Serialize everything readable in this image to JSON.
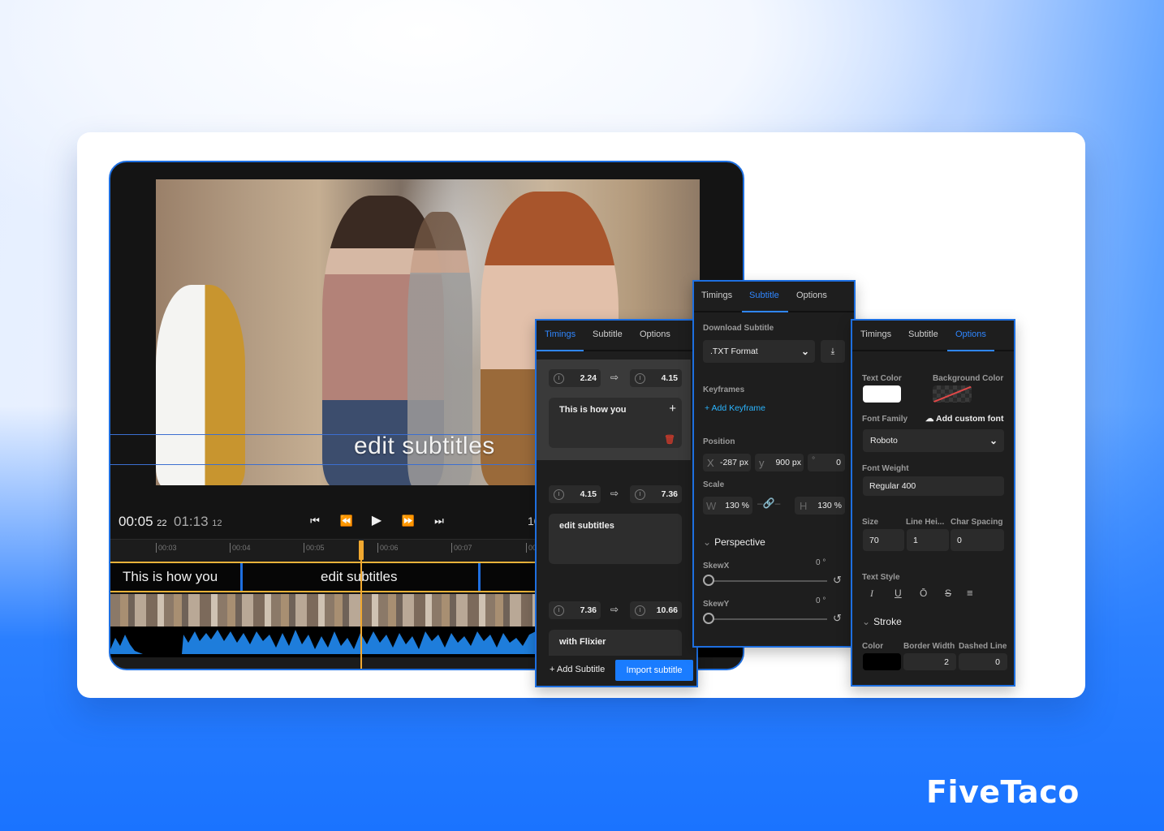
{
  "brand": {
    "logo": "FiveTaco",
    "accent": "#1e6fe0",
    "primary_button": "#1a7cff",
    "playhead": "#f0a830"
  },
  "player": {
    "video_caption": "edit subtitles",
    "current_time": "00:05",
    "current_frame": "22",
    "total_time": "01:13",
    "total_frame": "12",
    "zoom_partial": "10",
    "controls": [
      "skip-back",
      "rewind",
      "play",
      "fast-forward",
      "skip-forward"
    ],
    "ruler_ticks": [
      "00:03",
      "00:04",
      "00:05",
      "00:06",
      "00:07",
      "00:0"
    ],
    "subtitle_segments": [
      "This is how you",
      "edit subtitles"
    ]
  },
  "timings_panel": {
    "tabs": [
      "Timings",
      "Subtitle",
      "Options"
    ],
    "active_tab": "Timings",
    "entries": [
      {
        "start": "2.24",
        "end": "4.15",
        "text": "This is how you"
      },
      {
        "start": "4.15",
        "end": "7.36",
        "text": "edit subtitles"
      },
      {
        "start": "7.36",
        "end": "10.66",
        "text": "with Flixier"
      }
    ],
    "add_subtitle_label": "+ Add Subtitle",
    "import_label": "Import subtitle"
  },
  "subtitle_panel": {
    "tabs": [
      "Timings",
      "Subtitle",
      "Options"
    ],
    "active_tab": "Subtitle",
    "download_label": "Download Subtitle",
    "format_value": ".TXT Format",
    "keyframes_label": "Keyframes",
    "add_keyframe_label": "+ Add Keyframe",
    "position_label": "Position",
    "position": {
      "x_prefix": "X",
      "x": "-287 px",
      "y_prefix": "y",
      "y": "900 px",
      "rot_prefix": "°",
      "rotation": "0"
    },
    "scale_label": "Scale",
    "scale": {
      "w_prefix": "W",
      "w": "130 %",
      "h_prefix": "H",
      "h": "130 %"
    },
    "perspective_label": "Perspective",
    "skewx_label": "SkewX",
    "skewx_value": "0 °",
    "skewy_label": "SkewY",
    "skewy_value": "0 °"
  },
  "options_panel": {
    "tabs": [
      "Timings",
      "Subtitle",
      "Options"
    ],
    "active_tab": "Options",
    "text_color_label": "Text Color",
    "text_color": "#ffffff",
    "bg_color_label": "Background Color",
    "font_family_label": "Font Family",
    "add_font_label": "Add custom font",
    "font_family_value": "Roboto",
    "font_weight_label": "Font Weight",
    "font_weight_value": "Regular 400",
    "size_label": "Size",
    "size_value": "70",
    "line_height_label": "Line Hei...",
    "line_height_value": "1",
    "char_spacing_label": "Char Spacing",
    "char_spacing_value": "0",
    "text_style_label": "Text Style",
    "text_styles": [
      "I",
      "U",
      "Ō",
      "S",
      "≡"
    ],
    "stroke_label": "Stroke",
    "stroke_color_label": "Color",
    "stroke_color": "#000000",
    "border_width_label": "Border Width",
    "border_width_value": "2",
    "dashed_line_label": "Dashed Line",
    "dashed_line_value": "0"
  }
}
